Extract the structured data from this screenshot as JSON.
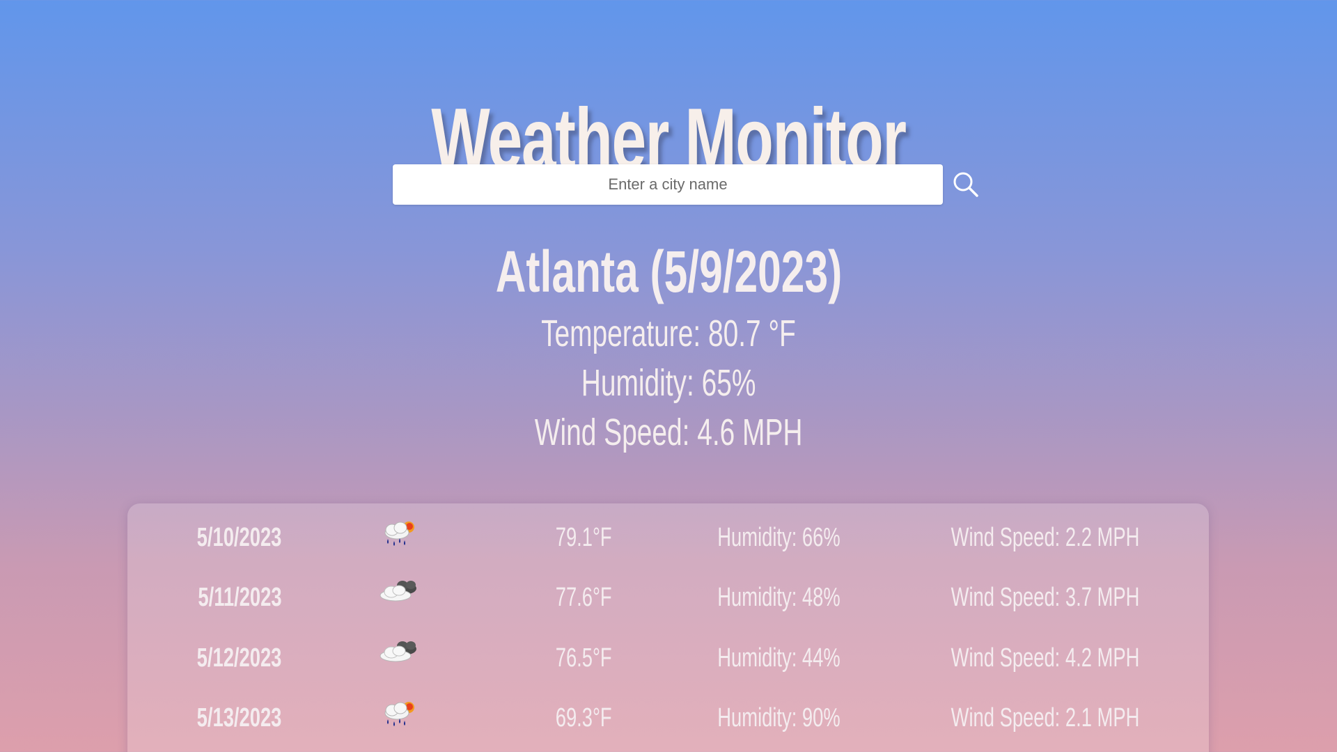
{
  "header": {
    "title": "Weather Monitor"
  },
  "search": {
    "placeholder": "Enter a city name",
    "value": "",
    "icon": "search-icon"
  },
  "current": {
    "heading": "Atlanta (5/9/2023)",
    "temperature": "Temperature: 80.7 °F",
    "humidity": "Humidity: 65%",
    "wind": "Wind Speed: 4.6 MPH"
  },
  "forecast": [
    {
      "date": "5/10/2023",
      "icon": "rain-sun-cloud-icon",
      "temp": "79.1°F",
      "humidity": "Humidity: 66%",
      "wind": "Wind Speed: 2.2 MPH"
    },
    {
      "date": "5/11/2023",
      "icon": "cloudy-icon",
      "temp": "77.6°F",
      "humidity": "Humidity: 48%",
      "wind": "Wind Speed: 3.7 MPH"
    },
    {
      "date": "5/12/2023",
      "icon": "cloudy-icon",
      "temp": "76.5°F",
      "humidity": "Humidity: 44%",
      "wind": "Wind Speed: 4.2 MPH"
    },
    {
      "date": "5/13/2023",
      "icon": "rain-sun-cloud-icon",
      "temp": "69.3°F",
      "humidity": "Humidity: 90%",
      "wind": "Wind Speed: 2.1 MPH"
    }
  ],
  "colors": {
    "background_top": "#6196eb",
    "background_bottom": "#dd9fac",
    "text": "#f5efef"
  }
}
